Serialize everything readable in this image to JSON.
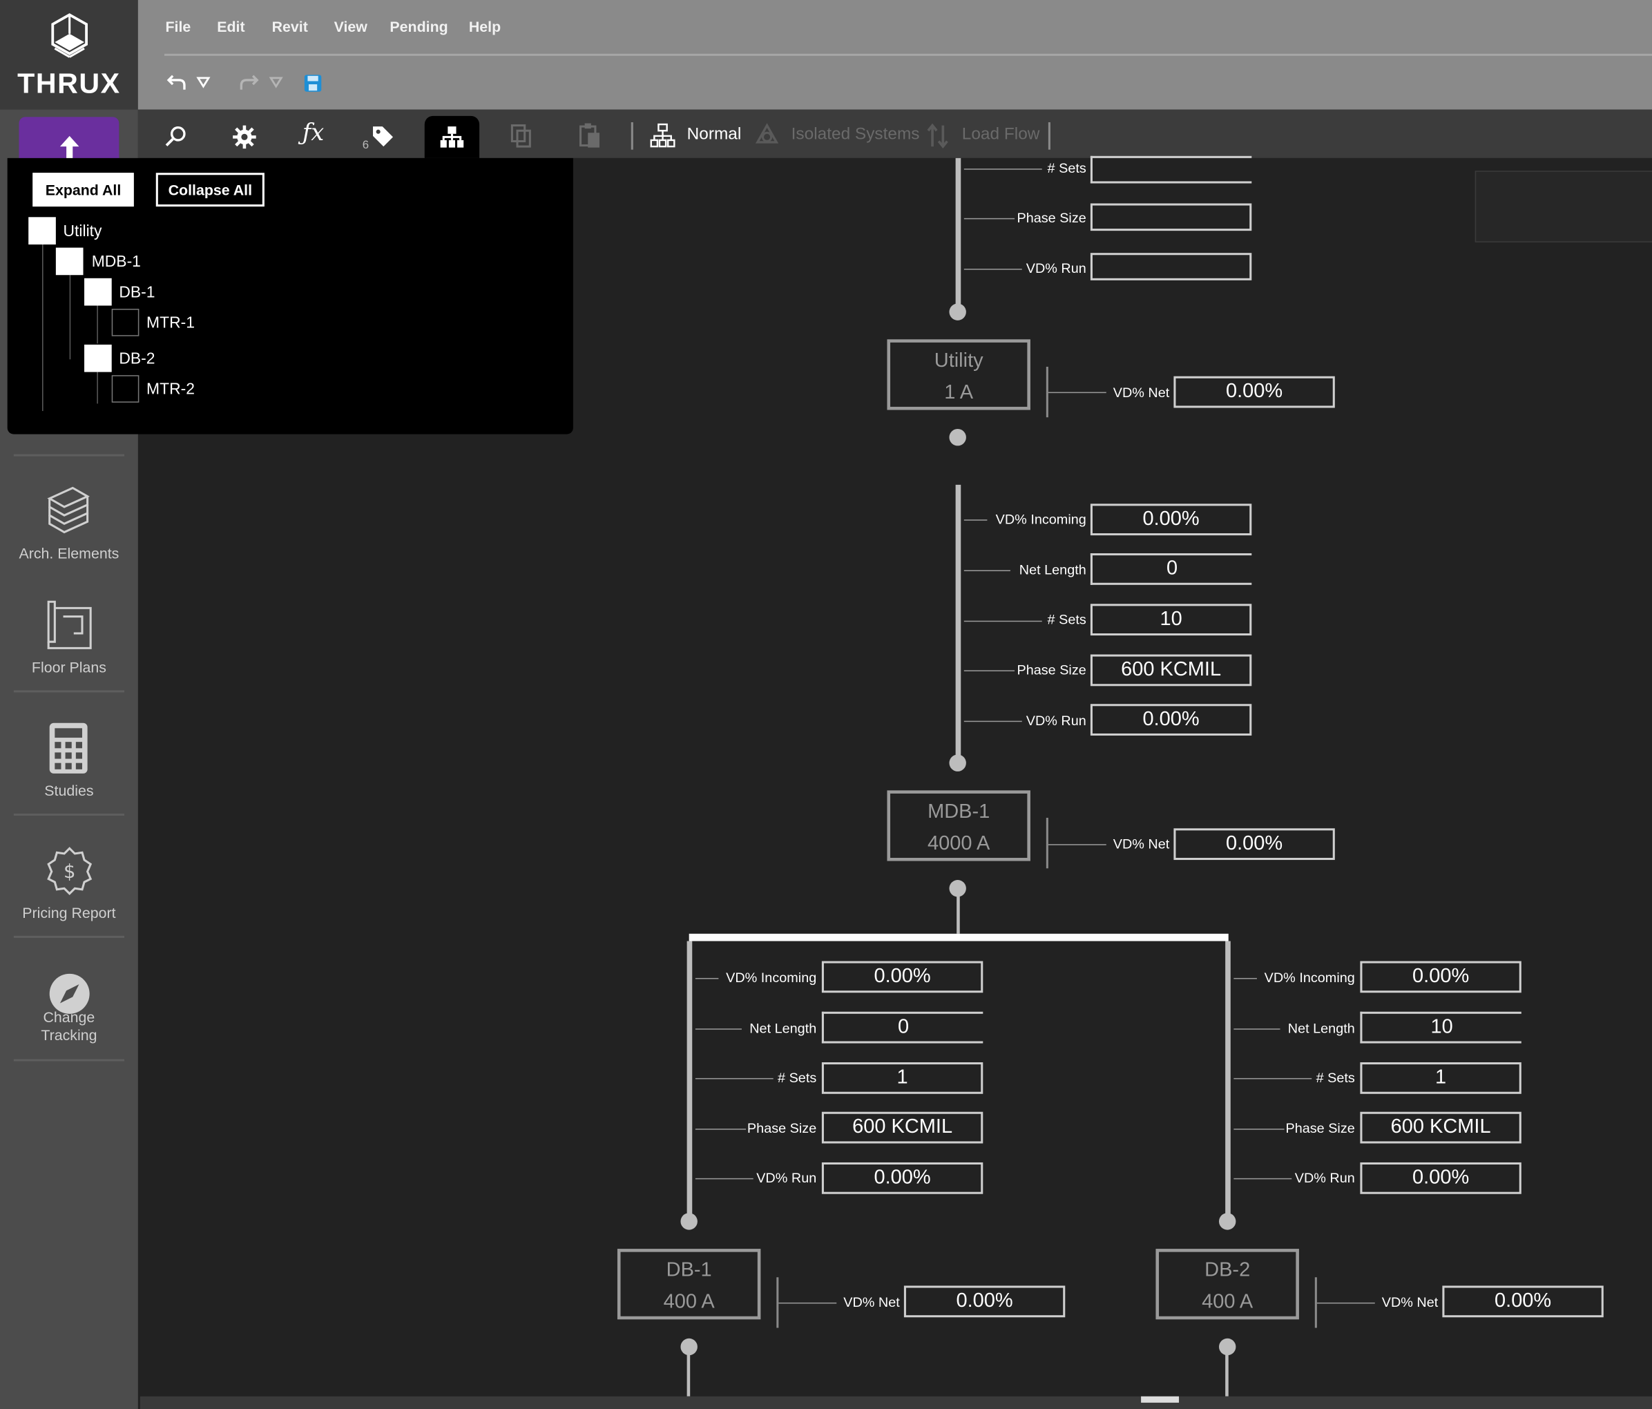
{
  "app": {
    "logo_text": "THRUX"
  },
  "menu": {
    "items": [
      "File",
      "Edit",
      "Revit",
      "View",
      "Pending",
      "Help"
    ]
  },
  "toolbar": {
    "badge_count": "6",
    "mode_label": "Normal",
    "isolated_label": "Isolated Systems",
    "loadflow_label": "Load Flow"
  },
  "sidebar": {
    "arch": "Arch. Elements",
    "floor": "Floor Plans",
    "studies": "Studies",
    "pricing": "Pricing Report",
    "change_l1": "Change",
    "change_l2": "Tracking"
  },
  "tree": {
    "expand_all": "Expand All",
    "collapse_all": "Collapse All",
    "nodes": [
      {
        "label": "Utility",
        "checked": true
      },
      {
        "label": "MDB-1",
        "checked": true
      },
      {
        "label": "DB-1",
        "checked": true
      },
      {
        "label": "MTR-1",
        "checked": false
      },
      {
        "label": "DB-2",
        "checked": true
      },
      {
        "label": "MTR-2",
        "checked": false
      }
    ]
  },
  "labels": {
    "vd_incoming": "VD% Incoming",
    "net_length": "Net Length",
    "sets": "# Sets",
    "phase_size": "Phase Size",
    "vd_run": "VD% Run",
    "vd_net": "VD% Net"
  },
  "top_feeder": {
    "sets": "",
    "phase_size": "",
    "vd_run": ""
  },
  "utility": {
    "name": "Utility",
    "rating": "1 A",
    "vd_net": "0.00%"
  },
  "feeder_mdb1": {
    "vd_incoming": "0.00%",
    "net_length": "0",
    "sets": "10",
    "phase_size": "600 KCMIL",
    "vd_run": "0.00%"
  },
  "mdb1": {
    "name": "MDB-1",
    "rating": "4000 A",
    "vd_net": "0.00%"
  },
  "feeder_db1": {
    "vd_incoming": "0.00%",
    "net_length": "0",
    "sets": "1",
    "phase_size": "600 KCMIL",
    "vd_run": "0.00%"
  },
  "feeder_db2": {
    "vd_incoming": "0.00%",
    "net_length": "10",
    "sets": "1",
    "phase_size": "600 KCMIL",
    "vd_run": "0.00%"
  },
  "db1": {
    "name": "DB-1",
    "rating": "400 A",
    "vd_net": "0.00%"
  },
  "db2": {
    "name": "DB-2",
    "rating": "400 A",
    "vd_net": "0.00%"
  }
}
